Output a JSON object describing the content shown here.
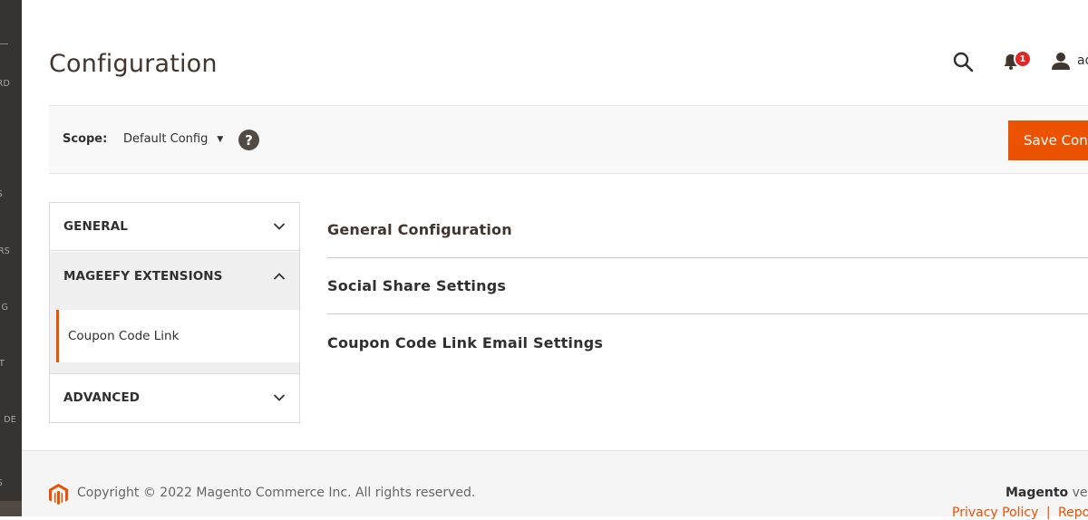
{
  "sidebar": {
    "items": [
      "RD",
      "S",
      "RS",
      "G",
      "T",
      "DE",
      "S"
    ]
  },
  "header": {
    "title": "Configuration",
    "notifications_count": "1",
    "user_name": "admin"
  },
  "scope": {
    "label": "Scope:",
    "value": "Default Config",
    "help": "?"
  },
  "toolbar": {
    "save_label": "Save Config"
  },
  "nav": {
    "tabs": [
      {
        "label": "GENERAL"
      },
      {
        "label": "MAGEEFY EXTENSIONS"
      },
      {
        "label": "ADVANCED"
      }
    ],
    "sub_items": [
      {
        "label": "Coupon Code Link"
      }
    ]
  },
  "sections": [
    {
      "label": "General Configuration"
    },
    {
      "label": "Social Share Settings"
    },
    {
      "label": "Coupon Code Link Email Settings"
    }
  ],
  "footer": {
    "copyright": "Copyright © 2022 Magento Commerce Inc. All rights reserved.",
    "brand": "Magento",
    "version_prefix": " ver.",
    "privacy_policy": "Privacy Policy",
    "separator": "|",
    "report": "Report"
  },
  "colors": {
    "accent": "#eb5202",
    "sidebar": "#373330",
    "badge": "#e22626"
  }
}
